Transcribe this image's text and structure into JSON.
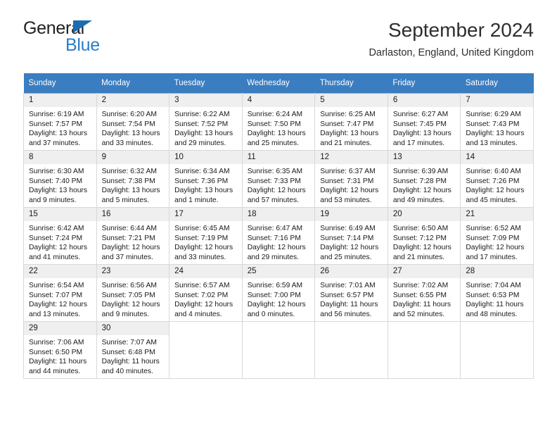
{
  "brand": {
    "name_part1": "General",
    "name_part2": "Blue",
    "primary_color": "#2a7fc9",
    "triangle_color": "#1b6cb0"
  },
  "header": {
    "title": "September 2024",
    "subtitle": "Darlaston, England, United Kingdom"
  },
  "calendar": {
    "header_bg": "#3a7dc0",
    "daynum_bg": "#efefef",
    "weekday_headers": [
      "Sunday",
      "Monday",
      "Tuesday",
      "Wednesday",
      "Thursday",
      "Friday",
      "Saturday"
    ],
    "weeks": [
      [
        {
          "day": "1",
          "sunrise": "Sunrise: 6:19 AM",
          "sunset": "Sunset: 7:57 PM",
          "daylight_line1": "Daylight: 13 hours",
          "daylight_line2": "and 37 minutes."
        },
        {
          "day": "2",
          "sunrise": "Sunrise: 6:20 AM",
          "sunset": "Sunset: 7:54 PM",
          "daylight_line1": "Daylight: 13 hours",
          "daylight_line2": "and 33 minutes."
        },
        {
          "day": "3",
          "sunrise": "Sunrise: 6:22 AM",
          "sunset": "Sunset: 7:52 PM",
          "daylight_line1": "Daylight: 13 hours",
          "daylight_line2": "and 29 minutes."
        },
        {
          "day": "4",
          "sunrise": "Sunrise: 6:24 AM",
          "sunset": "Sunset: 7:50 PM",
          "daylight_line1": "Daylight: 13 hours",
          "daylight_line2": "and 25 minutes."
        },
        {
          "day": "5",
          "sunrise": "Sunrise: 6:25 AM",
          "sunset": "Sunset: 7:47 PM",
          "daylight_line1": "Daylight: 13 hours",
          "daylight_line2": "and 21 minutes."
        },
        {
          "day": "6",
          "sunrise": "Sunrise: 6:27 AM",
          "sunset": "Sunset: 7:45 PM",
          "daylight_line1": "Daylight: 13 hours",
          "daylight_line2": "and 17 minutes."
        },
        {
          "day": "7",
          "sunrise": "Sunrise: 6:29 AM",
          "sunset": "Sunset: 7:43 PM",
          "daylight_line1": "Daylight: 13 hours",
          "daylight_line2": "and 13 minutes."
        }
      ],
      [
        {
          "day": "8",
          "sunrise": "Sunrise: 6:30 AM",
          "sunset": "Sunset: 7:40 PM",
          "daylight_line1": "Daylight: 13 hours",
          "daylight_line2": "and 9 minutes."
        },
        {
          "day": "9",
          "sunrise": "Sunrise: 6:32 AM",
          "sunset": "Sunset: 7:38 PM",
          "daylight_line1": "Daylight: 13 hours",
          "daylight_line2": "and 5 minutes."
        },
        {
          "day": "10",
          "sunrise": "Sunrise: 6:34 AM",
          "sunset": "Sunset: 7:36 PM",
          "daylight_line1": "Daylight: 13 hours",
          "daylight_line2": "and 1 minute."
        },
        {
          "day": "11",
          "sunrise": "Sunrise: 6:35 AM",
          "sunset": "Sunset: 7:33 PM",
          "daylight_line1": "Daylight: 12 hours",
          "daylight_line2": "and 57 minutes."
        },
        {
          "day": "12",
          "sunrise": "Sunrise: 6:37 AM",
          "sunset": "Sunset: 7:31 PM",
          "daylight_line1": "Daylight: 12 hours",
          "daylight_line2": "and 53 minutes."
        },
        {
          "day": "13",
          "sunrise": "Sunrise: 6:39 AM",
          "sunset": "Sunset: 7:28 PM",
          "daylight_line1": "Daylight: 12 hours",
          "daylight_line2": "and 49 minutes."
        },
        {
          "day": "14",
          "sunrise": "Sunrise: 6:40 AM",
          "sunset": "Sunset: 7:26 PM",
          "daylight_line1": "Daylight: 12 hours",
          "daylight_line2": "and 45 minutes."
        }
      ],
      [
        {
          "day": "15",
          "sunrise": "Sunrise: 6:42 AM",
          "sunset": "Sunset: 7:24 PM",
          "daylight_line1": "Daylight: 12 hours",
          "daylight_line2": "and 41 minutes."
        },
        {
          "day": "16",
          "sunrise": "Sunrise: 6:44 AM",
          "sunset": "Sunset: 7:21 PM",
          "daylight_line1": "Daylight: 12 hours",
          "daylight_line2": "and 37 minutes."
        },
        {
          "day": "17",
          "sunrise": "Sunrise: 6:45 AM",
          "sunset": "Sunset: 7:19 PM",
          "daylight_line1": "Daylight: 12 hours",
          "daylight_line2": "and 33 minutes."
        },
        {
          "day": "18",
          "sunrise": "Sunrise: 6:47 AM",
          "sunset": "Sunset: 7:16 PM",
          "daylight_line1": "Daylight: 12 hours",
          "daylight_line2": "and 29 minutes."
        },
        {
          "day": "19",
          "sunrise": "Sunrise: 6:49 AM",
          "sunset": "Sunset: 7:14 PM",
          "daylight_line1": "Daylight: 12 hours",
          "daylight_line2": "and 25 minutes."
        },
        {
          "day": "20",
          "sunrise": "Sunrise: 6:50 AM",
          "sunset": "Sunset: 7:12 PM",
          "daylight_line1": "Daylight: 12 hours",
          "daylight_line2": "and 21 minutes."
        },
        {
          "day": "21",
          "sunrise": "Sunrise: 6:52 AM",
          "sunset": "Sunset: 7:09 PM",
          "daylight_line1": "Daylight: 12 hours",
          "daylight_line2": "and 17 minutes."
        }
      ],
      [
        {
          "day": "22",
          "sunrise": "Sunrise: 6:54 AM",
          "sunset": "Sunset: 7:07 PM",
          "daylight_line1": "Daylight: 12 hours",
          "daylight_line2": "and 13 minutes."
        },
        {
          "day": "23",
          "sunrise": "Sunrise: 6:56 AM",
          "sunset": "Sunset: 7:05 PM",
          "daylight_line1": "Daylight: 12 hours",
          "daylight_line2": "and 9 minutes."
        },
        {
          "day": "24",
          "sunrise": "Sunrise: 6:57 AM",
          "sunset": "Sunset: 7:02 PM",
          "daylight_line1": "Daylight: 12 hours",
          "daylight_line2": "and 4 minutes."
        },
        {
          "day": "25",
          "sunrise": "Sunrise: 6:59 AM",
          "sunset": "Sunset: 7:00 PM",
          "daylight_line1": "Daylight: 12 hours",
          "daylight_line2": "and 0 minutes."
        },
        {
          "day": "26",
          "sunrise": "Sunrise: 7:01 AM",
          "sunset": "Sunset: 6:57 PM",
          "daylight_line1": "Daylight: 11 hours",
          "daylight_line2": "and 56 minutes."
        },
        {
          "day": "27",
          "sunrise": "Sunrise: 7:02 AM",
          "sunset": "Sunset: 6:55 PM",
          "daylight_line1": "Daylight: 11 hours",
          "daylight_line2": "and 52 minutes."
        },
        {
          "day": "28",
          "sunrise": "Sunrise: 7:04 AM",
          "sunset": "Sunset: 6:53 PM",
          "daylight_line1": "Daylight: 11 hours",
          "daylight_line2": "and 48 minutes."
        }
      ],
      [
        {
          "day": "29",
          "sunrise": "Sunrise: 7:06 AM",
          "sunset": "Sunset: 6:50 PM",
          "daylight_line1": "Daylight: 11 hours",
          "daylight_line2": "and 44 minutes."
        },
        {
          "day": "30",
          "sunrise": "Sunrise: 7:07 AM",
          "sunset": "Sunset: 6:48 PM",
          "daylight_line1": "Daylight: 11 hours",
          "daylight_line2": "and 40 minutes."
        },
        null,
        null,
        null,
        null,
        null
      ]
    ]
  }
}
